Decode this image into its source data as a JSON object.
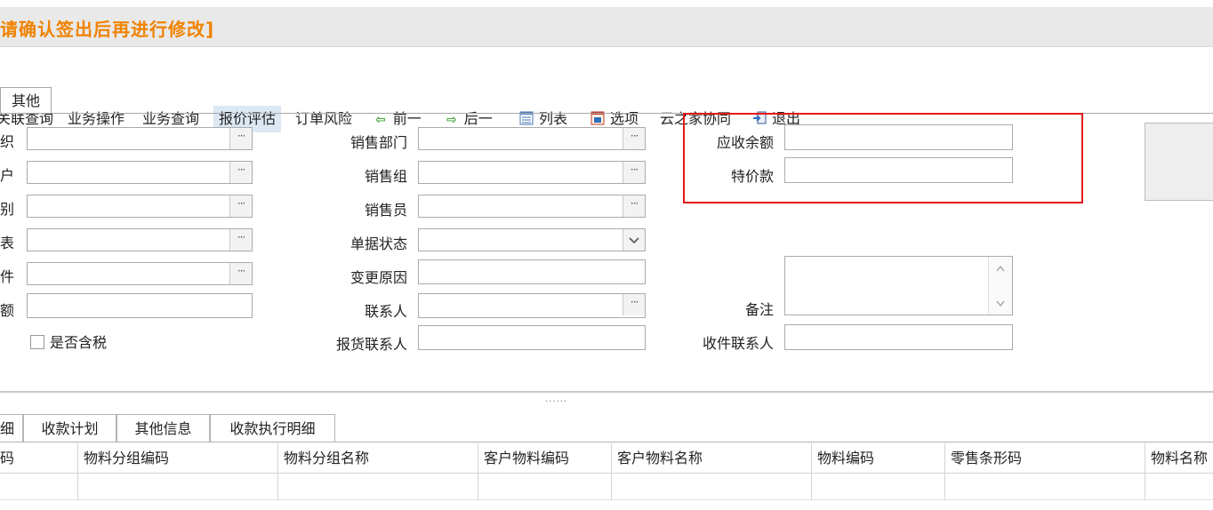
{
  "title": "请确认签出后再进行修改]",
  "toolbar": {
    "items": [
      {
        "label": "关联查询"
      },
      {
        "label": "业务操作"
      },
      {
        "label": "业务查询"
      },
      {
        "label": "报价评估"
      },
      {
        "label": "订单风险"
      },
      {
        "label": "前一",
        "icon": "arrow-left-icon"
      },
      {
        "label": "后一",
        "icon": "arrow-right-icon"
      },
      {
        "label": "列表",
        "icon": "list-icon"
      },
      {
        "label": "选项",
        "icon": "options-icon"
      },
      {
        "label": "云之家协同"
      },
      {
        "label": "退出",
        "icon": "exit-icon"
      }
    ]
  },
  "tabs": {
    "other": "其他"
  },
  "form": {
    "left_labels": [
      "织",
      "户",
      "别",
      "表",
      "件",
      "额"
    ],
    "tax_included": "是否含税",
    "mid_labels": {
      "sales_dept": "销售部门",
      "sales_group": "销售组",
      "salesperson": "销售员",
      "doc_status": "单据状态",
      "change_reason": "变更原因",
      "contact": "联系人",
      "quote_contact": "报货联系人"
    },
    "right_labels": {
      "receivable_balance": "应收余额",
      "special_price": "特价款",
      "remark": "备注",
      "receiver_contact": "收件联系人"
    }
  },
  "splitter": "......",
  "bottom_tabs": [
    "细",
    "收款计划",
    "其他信息",
    "收款执行明细"
  ],
  "grid": {
    "columns": [
      "码",
      "物料分组编码",
      "物料分组名称",
      "客户物料编码",
      "客户物料名称",
      "物料编码",
      "零售条形码",
      "物料名称"
    ]
  },
  "colors": {
    "title": "#f08300",
    "highlight": "#e31a1a",
    "active_tab": "#dce9f5"
  }
}
